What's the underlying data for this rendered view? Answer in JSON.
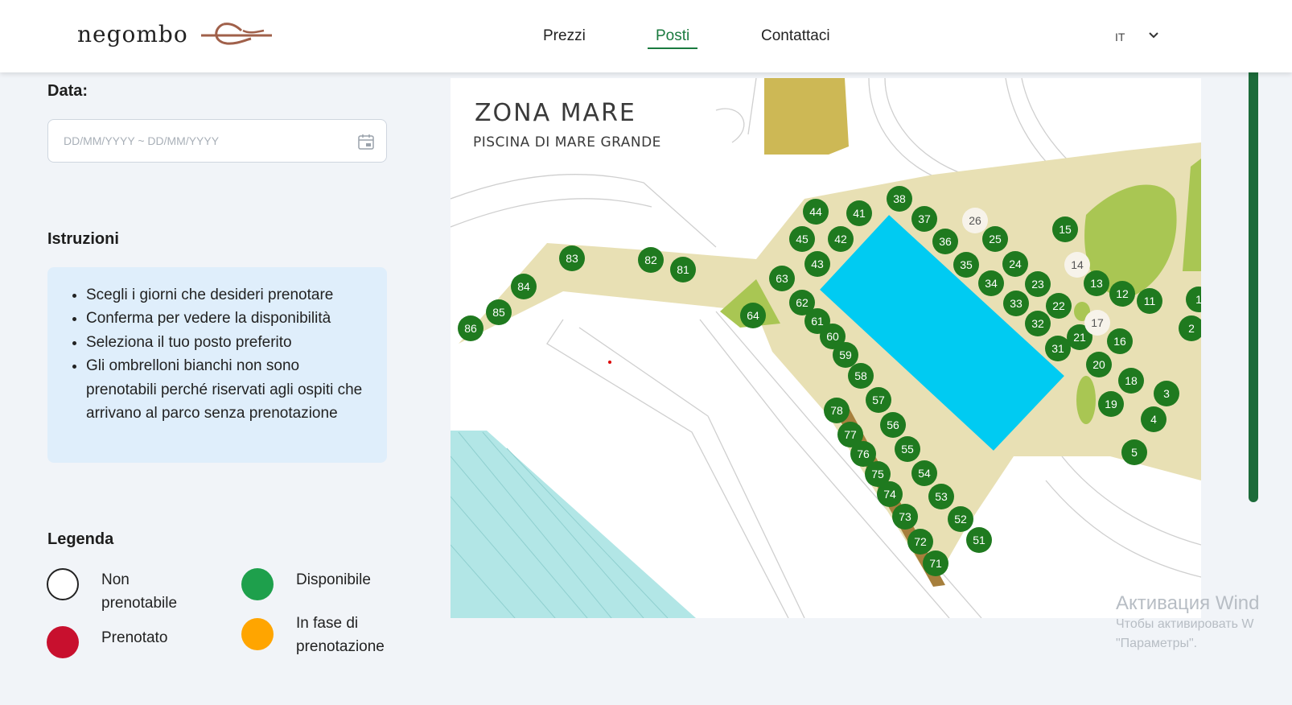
{
  "header": {
    "logo_text": "negombo",
    "nav": [
      {
        "label": "Prezzi",
        "active": false
      },
      {
        "label": "Posti",
        "active": true
      },
      {
        "label": "Contattaci",
        "active": false
      }
    ],
    "language": "IT"
  },
  "date_section": {
    "title": "Data:",
    "placeholder": "DD/MM/YYYY ~ DD/MM/YYYY",
    "value": ""
  },
  "instructions": {
    "title": "Istruzioni",
    "items": [
      "Scegli i giorni che desideri prenotare",
      "Conferma per vedere la disponibilità",
      "Seleziona il tuo posto preferito",
      "Gli ombrelloni bianchi non sono prenotabili perché riservati agli ospiti che arrivano al parco senza prenotazione"
    ]
  },
  "legend": {
    "title": "Legenda",
    "items": [
      {
        "label": "Non prenotabile",
        "color": "#ffffff"
      },
      {
        "label": "Disponibile",
        "color": "#1ea04c"
      },
      {
        "label": "Prenotato",
        "color": "#c8102e"
      },
      {
        "label": "In fase di prenotazione",
        "color": "#ffa500"
      }
    ]
  },
  "map": {
    "title": "ZONA MARE",
    "subtitle": "PISCINA DI MARE GRANDE",
    "colors": {
      "available": "#1f7a1f",
      "unavailable": "#f7f3ea",
      "pool": "#00cbf2",
      "sand": "#e8e0b4",
      "greenery": "#a9c653",
      "sea": "#b2e6e6"
    },
    "spots": [
      {
        "n": "86",
        "status": "available"
      },
      {
        "n": "85",
        "status": "available"
      },
      {
        "n": "84",
        "status": "available"
      },
      {
        "n": "83",
        "status": "available"
      },
      {
        "n": "82",
        "status": "available"
      },
      {
        "n": "81",
        "status": "available"
      },
      {
        "n": "64",
        "status": "available"
      },
      {
        "n": "63",
        "status": "available"
      },
      {
        "n": "62",
        "status": "available"
      },
      {
        "n": "61",
        "status": "available"
      },
      {
        "n": "60",
        "status": "available"
      },
      {
        "n": "59",
        "status": "available"
      },
      {
        "n": "58",
        "status": "available"
      },
      {
        "n": "57",
        "status": "available"
      },
      {
        "n": "56",
        "status": "available"
      },
      {
        "n": "55",
        "status": "available"
      },
      {
        "n": "54",
        "status": "available"
      },
      {
        "n": "53",
        "status": "available"
      },
      {
        "n": "52",
        "status": "available"
      },
      {
        "n": "51",
        "status": "available"
      },
      {
        "n": "78",
        "status": "available"
      },
      {
        "n": "77",
        "status": "available"
      },
      {
        "n": "76",
        "status": "available"
      },
      {
        "n": "75",
        "status": "available"
      },
      {
        "n": "74",
        "status": "available"
      },
      {
        "n": "73",
        "status": "available"
      },
      {
        "n": "72",
        "status": "available"
      },
      {
        "n": "71",
        "status": "available"
      },
      {
        "n": "44",
        "status": "available"
      },
      {
        "n": "41",
        "status": "available"
      },
      {
        "n": "38",
        "status": "available"
      },
      {
        "n": "37",
        "status": "available"
      },
      {
        "n": "45",
        "status": "available"
      },
      {
        "n": "42",
        "status": "available"
      },
      {
        "n": "43",
        "status": "available"
      },
      {
        "n": "36",
        "status": "available"
      },
      {
        "n": "26",
        "status": "unavailable"
      },
      {
        "n": "25",
        "status": "available"
      },
      {
        "n": "35",
        "status": "available"
      },
      {
        "n": "24",
        "status": "available"
      },
      {
        "n": "34",
        "status": "available"
      },
      {
        "n": "23",
        "status": "available"
      },
      {
        "n": "33",
        "status": "available"
      },
      {
        "n": "22",
        "status": "available"
      },
      {
        "n": "32",
        "status": "available"
      },
      {
        "n": "31",
        "status": "available"
      },
      {
        "n": "21",
        "status": "available"
      },
      {
        "n": "15",
        "status": "available"
      },
      {
        "n": "14",
        "status": "unavailable"
      },
      {
        "n": "13",
        "status": "available"
      },
      {
        "n": "12",
        "status": "available"
      },
      {
        "n": "11",
        "status": "available"
      },
      {
        "n": "17",
        "status": "unavailable"
      },
      {
        "n": "16",
        "status": "available"
      },
      {
        "n": "20",
        "status": "available"
      },
      {
        "n": "18",
        "status": "available"
      },
      {
        "n": "19",
        "status": "available"
      },
      {
        "n": "3",
        "status": "available"
      },
      {
        "n": "4",
        "status": "available"
      },
      {
        "n": "5",
        "status": "available"
      },
      {
        "n": "2",
        "status": "available"
      },
      {
        "n": "1",
        "status": "available"
      }
    ]
  },
  "watermark": {
    "line1": "Активация Wind",
    "line2": "Чтобы активировать W",
    "line3": "\"Параметры\"."
  }
}
